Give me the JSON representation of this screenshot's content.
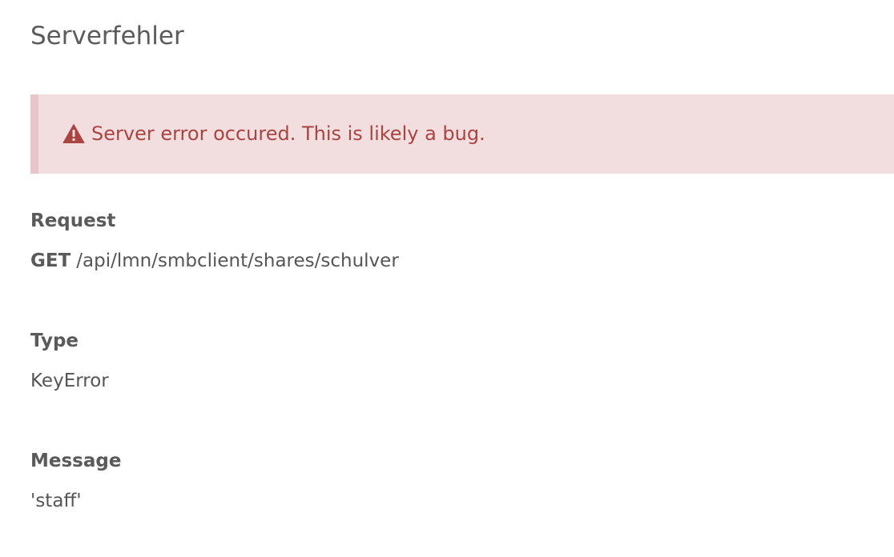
{
  "page": {
    "title": "Serverfehler"
  },
  "alert": {
    "icon": "warning-triangle-icon",
    "message": "Server error occured. This is likely a bug.",
    "colors": {
      "background": "#f2dede",
      "border": "#e8c6c8",
      "text": "#a94442"
    }
  },
  "request": {
    "label": "Request",
    "method": "GET",
    "path": "/api/lmn/smbclient/shares/schulver"
  },
  "type": {
    "label": "Type",
    "value": "KeyError"
  },
  "message": {
    "label": "Message",
    "value": "'staff'"
  }
}
